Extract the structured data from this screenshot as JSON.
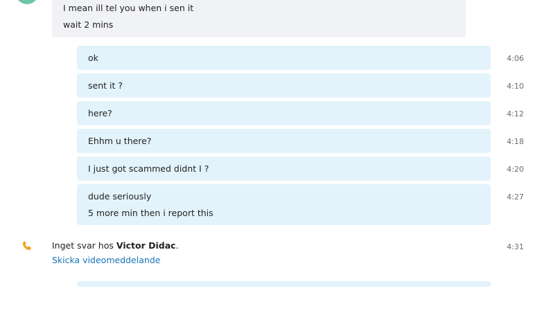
{
  "incoming": {
    "lines": [
      "I mean ill tel you when i sen it",
      "wait 2 mins"
    ]
  },
  "outgoing": [
    {
      "lines": [
        "ok"
      ],
      "time": "4:06"
    },
    {
      "lines": [
        "sent it ?"
      ],
      "time": "4:10"
    },
    {
      "lines": [
        "here?"
      ],
      "time": "4:12"
    },
    {
      "lines": [
        "Ehhm u there?"
      ],
      "time": "4:18"
    },
    {
      "lines": [
        "I just got scammed didnt I ?"
      ],
      "time": "4:20"
    },
    {
      "lines": [
        "dude seriously",
        "5 more min then i report this"
      ],
      "time": "4:27"
    }
  ],
  "call": {
    "icon": "phone-icon",
    "icon_color": "#f0a020",
    "text_prefix": "Inget svar hos ",
    "contact_name": "Victor Didac",
    "text_suffix": ".",
    "link_label": "Skicka videomeddelande",
    "time": "4:31"
  },
  "colors": {
    "incoming_bubble": "#f1f2f5",
    "outgoing_bubble": "#e3f3fc",
    "link": "#1a73b8",
    "avatar": "#6cc6a4"
  }
}
